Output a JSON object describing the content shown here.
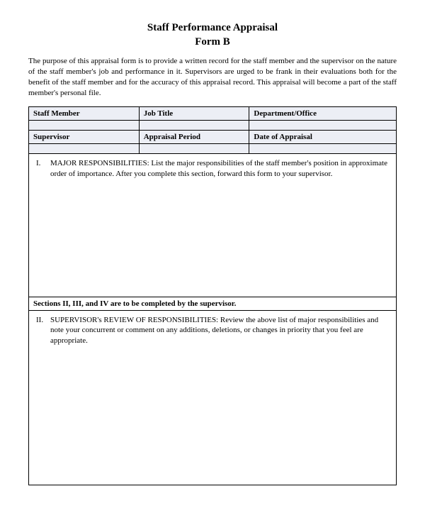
{
  "title": {
    "line1": "Staff Performance Appraisal",
    "line2": "Form B"
  },
  "intro": "The purpose of this appraisal form is to provide a written record for the staff member and the supervisor on the nature of the staff member's job and performance in it. Supervisors are urged to be frank in their evaluations both for the benefit of the staff member and for the accuracy of this appraisal record. This appraisal will become a part of the staff member's personal file.",
  "headers": {
    "row1": {
      "c1": "Staff Member",
      "c2": "Job Title",
      "c3": "Department/Office"
    },
    "row2": {
      "c1": "Supervisor",
      "c2": "Appraisal Period",
      "c3": "Date of Appraisal"
    }
  },
  "section1": {
    "roman": "I.",
    "text": "MAJOR RESPONSIBILITIES: List the major responsibilities of the staff member's position in approximate order of importance. After you complete this section, forward this form to your supervisor."
  },
  "divider": "Sections II, III, and IV are to be completed by the supervisor.",
  "section2": {
    "roman": "II.",
    "text": "SUPERVISOR's REVIEW OF RESPONSIBILITIES: Review the above list of major responsibilities and note your concurrent or comment on any additions, deletions, or changes in priority that you feel are appropriate."
  }
}
